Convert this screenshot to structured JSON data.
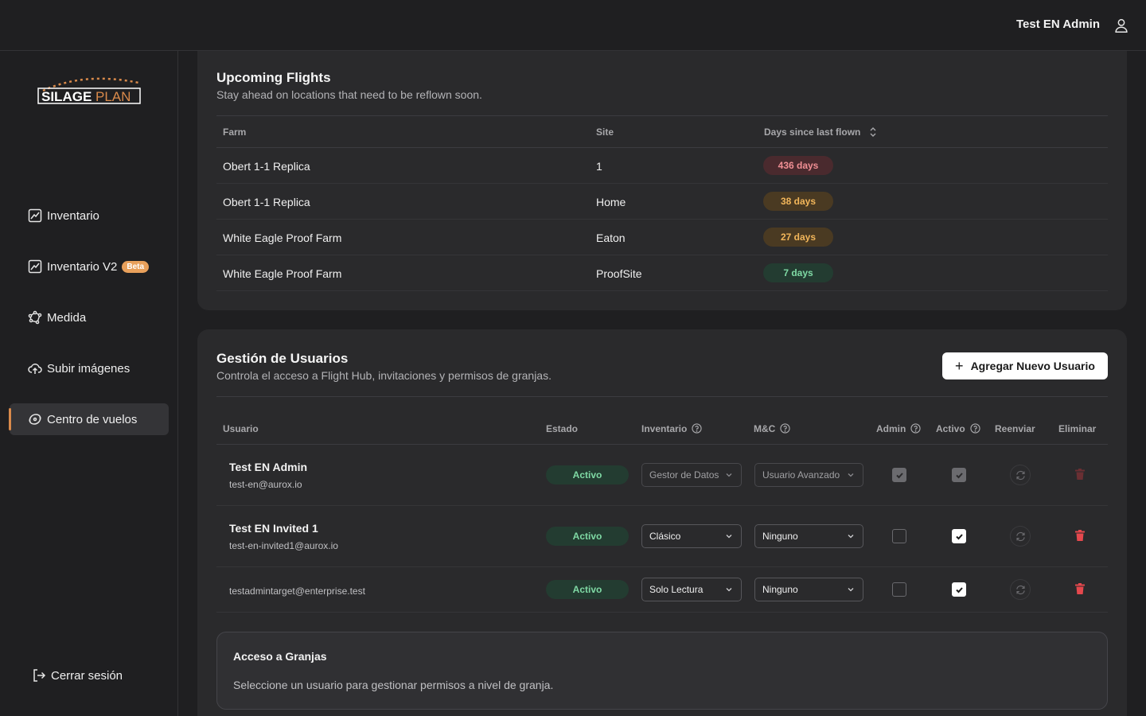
{
  "header": {
    "user_name": "Test EN Admin",
    "user_icon": "user-icon"
  },
  "sidebar": {
    "logo_text_1": "SILAGE",
    "logo_text_2": "PLAN",
    "items": [
      {
        "label": "Inventario",
        "icon": "chart-icon"
      },
      {
        "label": "Inventario V2",
        "icon": "chart-icon",
        "badge": "Beta"
      },
      {
        "label": "Medida",
        "icon": "polygon-icon"
      },
      {
        "label": "Subir imágenes",
        "icon": "cloud-upload-icon"
      },
      {
        "label": "Centro de vuelos",
        "icon": "drone-icon",
        "active": true
      }
    ],
    "logout_label": "Cerrar sesión"
  },
  "flights": {
    "title": "Upcoming Flights",
    "subtitle": "Stay ahead on locations that need to be reflown soon.",
    "columns": [
      "Farm",
      "Site",
      "Days since last flown"
    ],
    "rows": [
      {
        "farm": "Obert 1-1 Replica",
        "site": "1",
        "days": "436 days",
        "level": "red"
      },
      {
        "farm": "Obert 1-1 Replica",
        "site": "Home",
        "days": "38 days",
        "level": "orange"
      },
      {
        "farm": "White Eagle Proof Farm",
        "site": "Eaton",
        "days": "27 days",
        "level": "orange"
      },
      {
        "farm": "White Eagle Proof Farm",
        "site": "ProofSite",
        "days": "7 days",
        "level": "green"
      }
    ]
  },
  "users": {
    "title": "Gestión de Usuarios",
    "subtitle": "Controla el acceso a Flight Hub, invitaciones y permisos de granjas.",
    "add_button": "Agregar Nuevo Usuario",
    "columns": {
      "user": "Usuario",
      "status": "Estado",
      "inventory": "Inventario",
      "mc": "M&C",
      "admin": "Admin",
      "active": "Activo",
      "resend": "Reenviar",
      "delete": "Eliminar"
    },
    "rows": [
      {
        "name": "Test EN Admin",
        "email": "test-en@aurox.io",
        "status": "Activo",
        "inventory": "Gestor de Datos",
        "mc": "Usuario Avanzado",
        "admin": true,
        "active": true,
        "disabled": true
      },
      {
        "name": "Test EN Invited 1",
        "email": "test-en-invited1@aurox.io",
        "status": "Activo",
        "inventory": "Clásico",
        "mc": "Ninguno",
        "admin": false,
        "active": true,
        "disabled": false
      },
      {
        "name": "",
        "email": "testadmintarget@enterprise.test",
        "status": "Activo",
        "inventory": "Solo Lectura",
        "mc": "Ninguno",
        "admin": false,
        "active": true,
        "disabled": false
      }
    ],
    "farm_access": {
      "title": "Acceso a Granjas",
      "subtitle": "Seleccione un usuario para gestionar permisos a nivel de granja."
    }
  },
  "colors": {
    "accent": "#d98a4b",
    "beta": "#e8a05b",
    "danger": "#e5484d",
    "success": "#7fd9a4"
  }
}
